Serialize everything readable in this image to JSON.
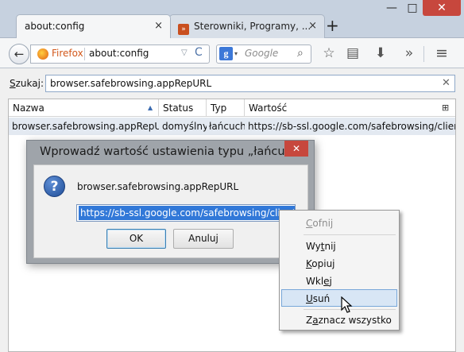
{
  "window": {
    "minimize": "—",
    "maximize": "□",
    "close": "✕"
  },
  "tabs": [
    {
      "label": "about:config",
      "close": "×",
      "active": true
    },
    {
      "label": "Sterowniki, Programy, ...",
      "close": "×",
      "active": false
    }
  ],
  "new_tab": "+",
  "nav": {
    "back": "←",
    "identity": "Firefox",
    "url": "about:config",
    "dropdown": "▽",
    "reload": "C",
    "search_engine": "g",
    "search_dropdown": "▾",
    "search_placeholder": "Google",
    "search_icon": "⌕",
    "star": "☆",
    "reader": "▤",
    "download": "⬇",
    "overflow": "»",
    "menu": "≡"
  },
  "filter": {
    "label_prefix": "S",
    "label_rest": "zukaj:",
    "value": "browser.safebrowsing.appRepURL",
    "clear": "✕"
  },
  "table": {
    "headers": [
      "Nazwa",
      "Status",
      "Typ",
      "Wartość"
    ],
    "sort_indicator": "▲",
    "column_picker": "⊞",
    "rows": [
      {
        "name": "browser.safebrowsing.appRepURL",
        "status": "domyślny",
        "type": "łańcuch",
        "value": "https://sb-ssl.google.com/safebrowsing/clientrep"
      }
    ]
  },
  "dialog": {
    "title": "Wprowadź wartość ustawienia typu „łańcuch”",
    "close": "✕",
    "icon": "?",
    "message": "browser.safebrowsing.appRepURL",
    "input_value": "https://sb-ssl.google.com/safebrowsing/clientrep",
    "ok": "OK",
    "cancel": "Anuluj"
  },
  "context_menu": {
    "items": [
      {
        "ul": "C",
        "rest": "ofnij",
        "disabled": true
      },
      {
        "pre": "Wy",
        "ul": "t",
        "rest": "nij"
      },
      {
        "ul": "K",
        "rest": "opiuj"
      },
      {
        "pre": "Wkl",
        "ul": "e",
        "rest": "j"
      },
      {
        "ul": "U",
        "rest": "suń",
        "hover": true
      },
      {
        "pre": "Z",
        "ul": "a",
        "rest": "znacz wszystko"
      }
    ]
  },
  "colors": {
    "accent": "#3178d8",
    "close_red": "#c7473d",
    "selection_row": "#e3e9f1",
    "menu_hover": "#d8e6f5"
  }
}
